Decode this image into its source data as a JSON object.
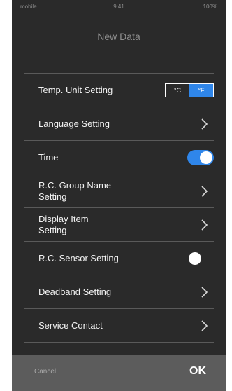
{
  "status_bar": {
    "carrier": "mobile",
    "time": "9:41",
    "battery": "100%"
  },
  "page": {
    "title": "New Data"
  },
  "settings": {
    "temp_unit": {
      "label": "Temp. Unit Setting",
      "options": [
        "°C",
        "°F"
      ],
      "selected": "°F"
    },
    "language": {
      "label": "Language Setting"
    },
    "time": {
      "label": "Time",
      "enabled": true
    },
    "rc_group_name": {
      "label": "R.C. Group Name Setting"
    },
    "display_item": {
      "label": "Display Item Setting"
    },
    "rc_sensor": {
      "label": "R.C. Sensor Setting",
      "enabled": false
    },
    "deadband": {
      "label": "Deadband Setting"
    },
    "service_contact": {
      "label": "Service Contact"
    }
  },
  "footer": {
    "cancel_label": "Cancel",
    "ok_label": "OK"
  },
  "colors": {
    "background": "#2a2a2a",
    "accent": "#2f86ea",
    "footer": "#5c5c5c"
  }
}
